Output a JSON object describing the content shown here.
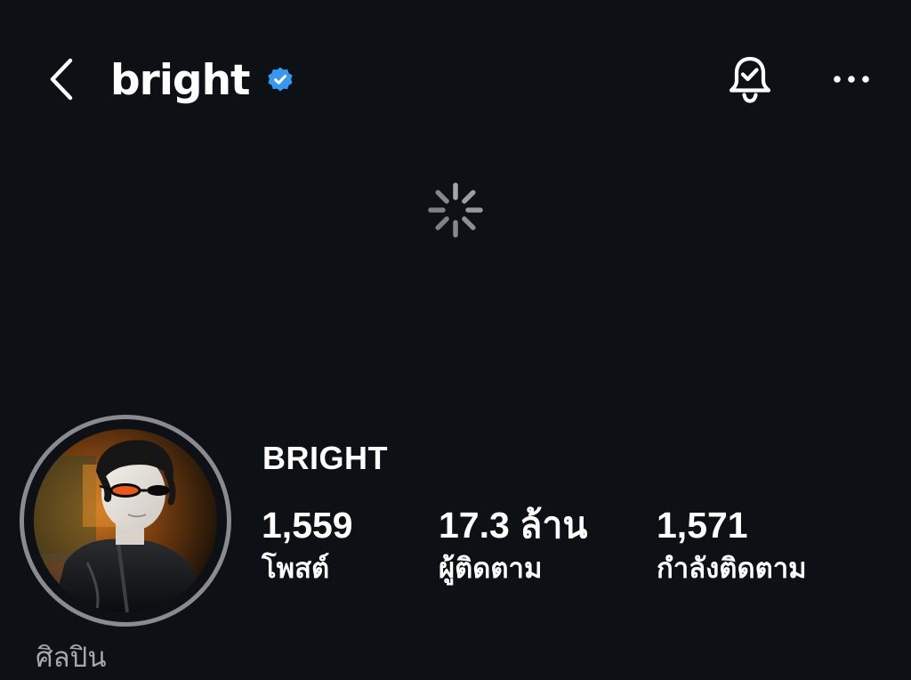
{
  "header": {
    "username": "bright",
    "verified": true,
    "accent_color": "#3897f0",
    "icons": [
      "chevron-left-icon",
      "verified-badge-icon",
      "bell-check-icon",
      "more-horizontal-icon"
    ]
  },
  "loading": {
    "icon": "activity-spinner-icon"
  },
  "profile": {
    "display_name": "BRIGHT",
    "stats": {
      "posts_value": "1,559",
      "posts_label": "โพสต์",
      "followers_value": "17.3 ล้าน",
      "followers_label": "ผู้ติดตาม",
      "following_value": "1,571",
      "following_label": "กำลังติดตาม"
    },
    "category": "ศิลปิน"
  },
  "colors": {
    "background": "#0d1015",
    "text_primary": "#ffffff",
    "text_secondary": "#a6a8ad",
    "avatar_ring": "#8a8b90",
    "verified_blue": "#3897f0"
  }
}
